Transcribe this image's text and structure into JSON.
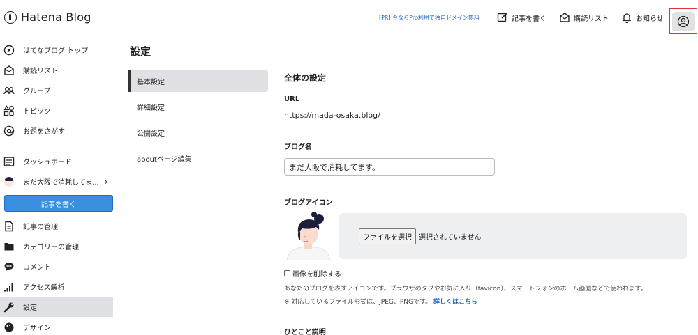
{
  "header": {
    "logo_text": "Hatena Blog",
    "pr_link": "[PR] 今ならPro利用で独自ドメイン無料",
    "write_label": "記事を書く",
    "reading_list_label": "購読リスト",
    "notifications_label": "お知らせ"
  },
  "sidebar": {
    "top_items": [
      {
        "label": "はてなブログ トップ",
        "icon": "compass-icon"
      },
      {
        "label": "購読リスト",
        "icon": "reading-list-icon"
      },
      {
        "label": "グループ",
        "icon": "group-icon"
      },
      {
        "label": "トピック",
        "icon": "topic-icon"
      },
      {
        "label": "お題をさがす",
        "icon": "search-topic-icon"
      }
    ],
    "dashboard_label": "ダッシュボード",
    "blog_name": "まだ大阪で消耗してま...",
    "write_button": "記事を書く",
    "manage_items": [
      {
        "label": "記事の管理",
        "icon": "document-icon"
      },
      {
        "label": "カテゴリーの管理",
        "icon": "folder-icon"
      },
      {
        "label": "コメント",
        "icon": "comment-icon"
      },
      {
        "label": "アクセス解析",
        "icon": "analytics-icon"
      },
      {
        "label": "設定",
        "icon": "wrench-icon"
      },
      {
        "label": "デザイン",
        "icon": "palette-icon"
      }
    ]
  },
  "page": {
    "title": "設定",
    "tabs": [
      {
        "label": "基本設定",
        "active": true
      },
      {
        "label": "詳細設定",
        "active": false
      },
      {
        "label": "公開設定",
        "active": false
      },
      {
        "label": "aboutページ編集",
        "active": false
      }
    ]
  },
  "settings": {
    "section_title": "全体の設定",
    "url_label": "URL",
    "url_value": "https://mada-osaka.blog/",
    "blog_name_label": "ブログ名",
    "blog_name_value": "まだ大阪で消耗してます。",
    "blog_icon_label": "ブログアイコン",
    "file_button": "ファイルを選択",
    "file_status": "選択されていません",
    "delete_image_label": "画像を削除する",
    "icon_description": "あなたのブログを表すアイコンです。ブラウザのタブやお気に入り（favicon）、スマートフォンのホーム画面などで使われます。",
    "formats_note": "※ 対応しているファイル形式は、JPEG、PNGです。",
    "details_link": "詳しくはこちら",
    "tagline_label": "ひとこと説明"
  },
  "colors": {
    "accent": "#3a90e0",
    "link": "#2a6bc1",
    "highlight_border": "#e3323b",
    "active_bg": "#dfe1e5"
  }
}
